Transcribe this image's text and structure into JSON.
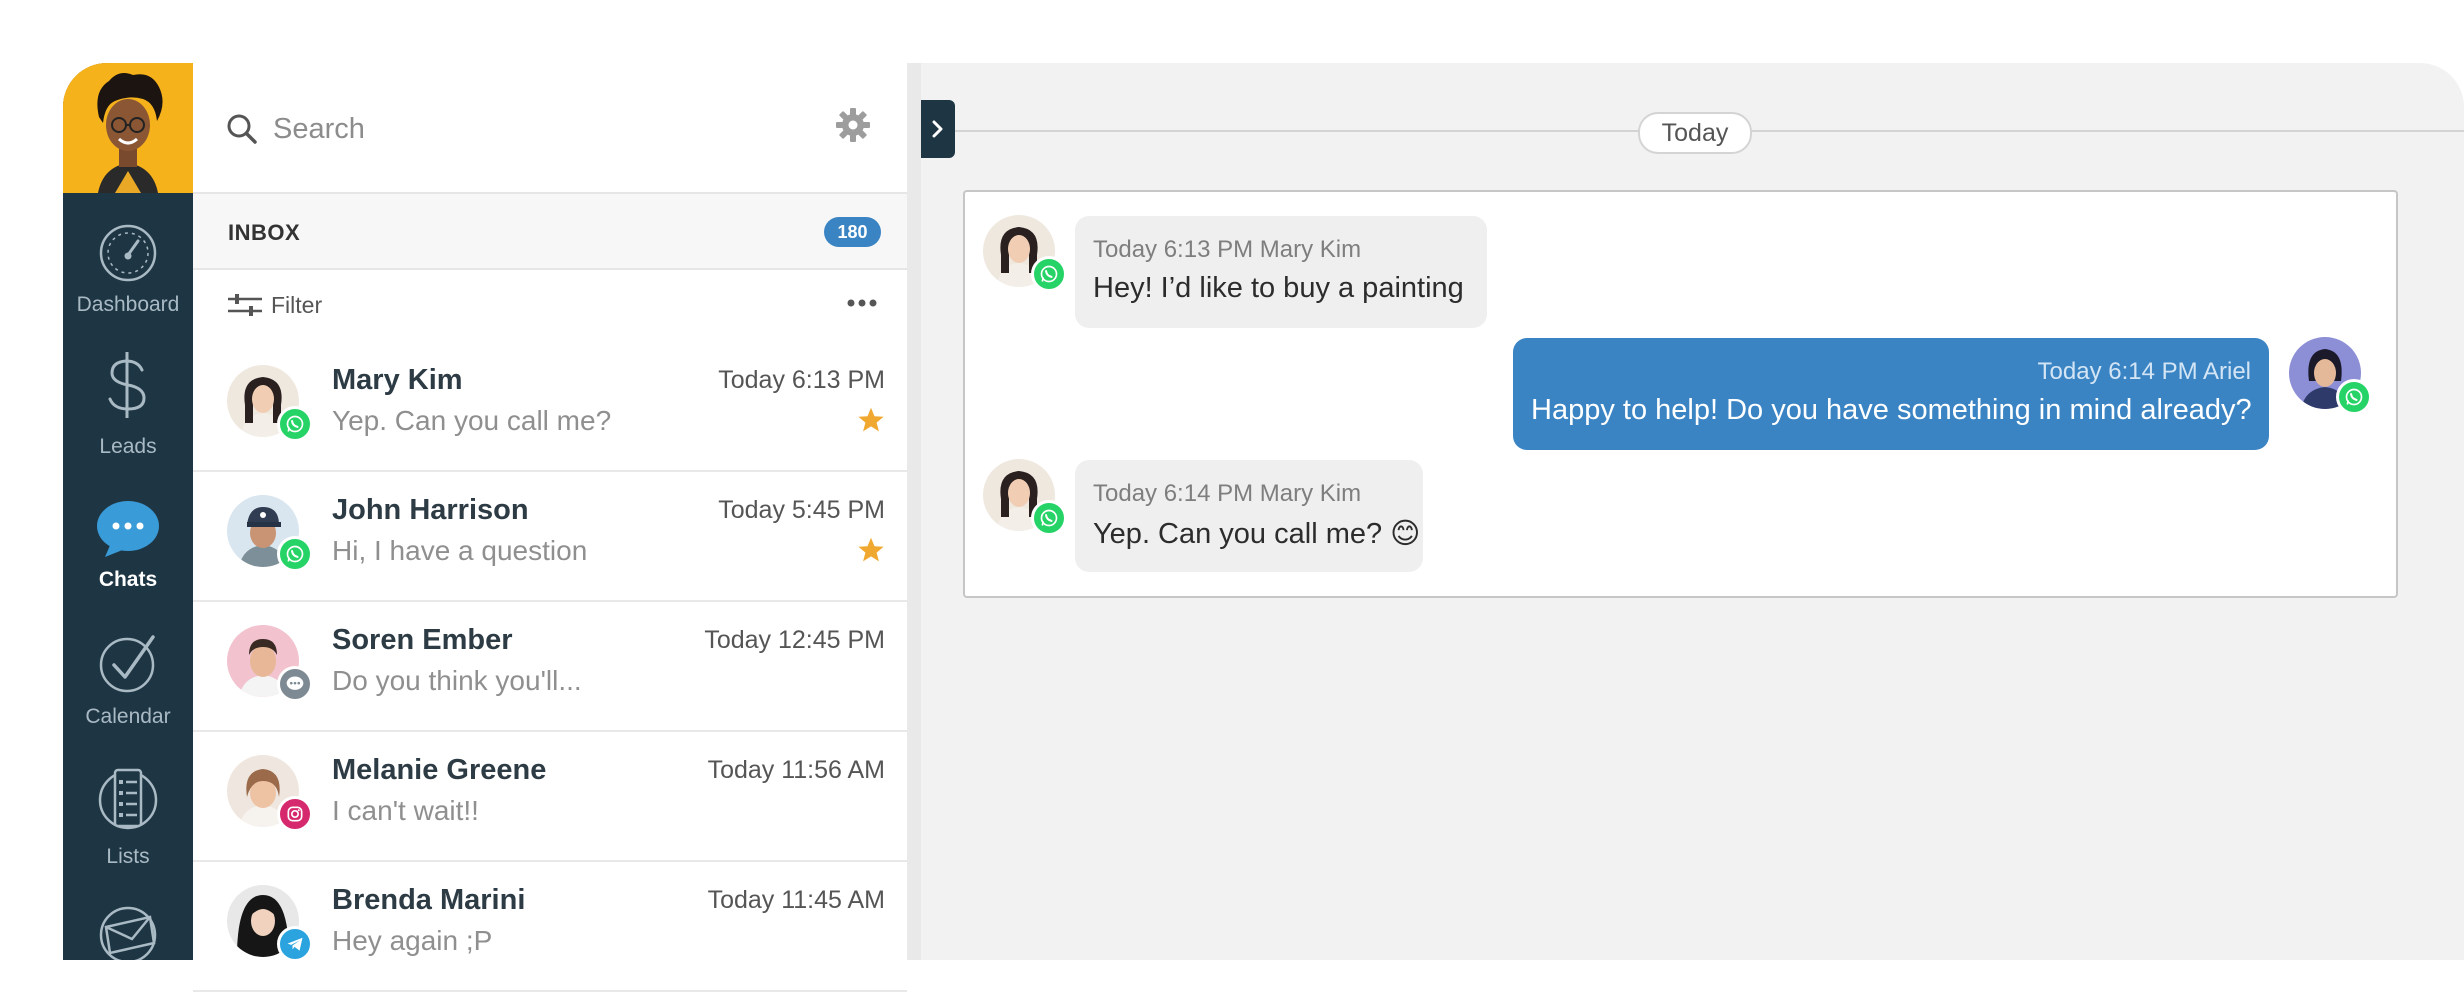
{
  "colors": {
    "nav_bg": "#1e3644",
    "accent_blue": "#3a84c4",
    "whatsapp_green": "#25d366",
    "star": "#f0a830",
    "user_avatar_bg": "#f6b21b"
  },
  "nav": {
    "items": [
      {
        "label": "Dashboard",
        "icon": "dashboard-gauge-icon"
      },
      {
        "label": "Leads",
        "icon": "dollar-icon"
      },
      {
        "label": "Chats",
        "icon": "chat-bubble-icon",
        "active": true
      },
      {
        "label": "Calendar",
        "icon": "checkmark-icon"
      },
      {
        "label": "Lists",
        "icon": "list-icon"
      },
      {
        "label": "",
        "icon": "mail-icon"
      }
    ]
  },
  "search": {
    "placeholder": "Search"
  },
  "inbox": {
    "label": "INBOX",
    "count": "180"
  },
  "filter": {
    "label": "Filter"
  },
  "chats": [
    {
      "name": "Mary Kim",
      "time": "Today 6:13 PM",
      "preview": "Yep. Can you call me?",
      "channel": "whatsapp",
      "starred": true
    },
    {
      "name": "John Harrison",
      "time": "Today 5:45 PM",
      "preview": "Hi, I have a question",
      "channel": "whatsapp",
      "starred": true
    },
    {
      "name": "Soren Ember",
      "time": "Today 12:45 PM",
      "preview": "Do you think you'll...",
      "channel": "sms",
      "starred": false
    },
    {
      "name": "Melanie Greene",
      "time": "Today 11:56 AM",
      "preview": "I can't wait!!",
      "channel": "instagram",
      "starred": false
    },
    {
      "name": "Brenda Marini",
      "time": "Today 11:45 AM",
      "preview": "Hey again ;P",
      "channel": "telegram",
      "starred": false
    }
  ],
  "conversation": {
    "date_label": "Today",
    "messages": [
      {
        "meta": "Today 6:13 PM Mary Kim",
        "text": "Hey! I’d like to buy a painting",
        "direction": "incoming",
        "channel": "whatsapp"
      },
      {
        "meta": "Today 6:14 PM Ariel",
        "text": "Happy to help! Do you have something in mind already?",
        "direction": "outgoing",
        "channel": "whatsapp"
      },
      {
        "meta": "Today 6:14 PM Mary Kim",
        "text": "Yep. Can you call me? 😊",
        "direction": "incoming",
        "channel": "whatsapp"
      }
    ]
  }
}
